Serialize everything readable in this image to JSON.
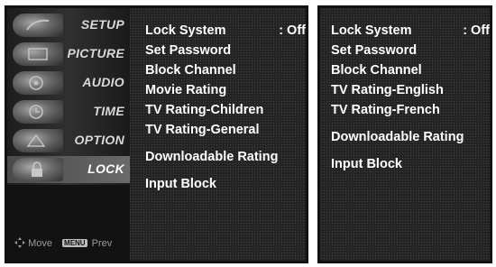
{
  "left_panel": {
    "side_menu": [
      {
        "label": "SETUP",
        "icon": "setup-icon"
      },
      {
        "label": "PICTURE",
        "icon": "picture-icon"
      },
      {
        "label": "AUDIO",
        "icon": "audio-icon"
      },
      {
        "label": "TIME",
        "icon": "time-icon"
      },
      {
        "label": "OPTION",
        "icon": "option-icon"
      },
      {
        "label": "LOCK",
        "icon": "lock-icon",
        "selected": true
      }
    ],
    "footer": {
      "move_label": "Move",
      "menu_key": "MENU",
      "prev_label": "Prev"
    },
    "items": [
      {
        "label": "Lock System",
        "value": ": Off"
      },
      {
        "label": "Set Password"
      },
      {
        "label": "Block Channel"
      },
      {
        "label": "Movie Rating"
      },
      {
        "label": "TV Rating-Children"
      },
      {
        "label": "TV Rating-General"
      },
      {
        "label": "Downloadable Rating"
      },
      {
        "label": "Input Block"
      }
    ]
  },
  "right_panel": {
    "items": [
      {
        "label": "Lock System",
        "value": ": Off"
      },
      {
        "label": "Set Password"
      },
      {
        "label": "Block Channel"
      },
      {
        "label": "TV Rating-English"
      },
      {
        "label": "TV Rating-French"
      },
      {
        "label": "Downloadable Rating"
      },
      {
        "label": "Input Block"
      }
    ]
  },
  "colors": {
    "panel_bg": "#0a0a0a",
    "text": "#ffffff",
    "selected_bg": "#5a5a5a"
  }
}
